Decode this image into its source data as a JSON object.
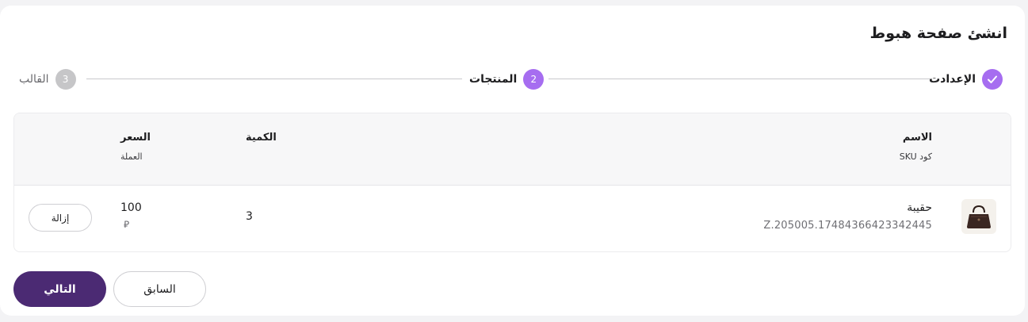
{
  "page": {
    "title": "انشئ صفحة هبوط"
  },
  "stepper": {
    "steps": [
      {
        "number": "1",
        "label": "الإعدادت",
        "state": "completed"
      },
      {
        "number": "2",
        "label": "المنتجات",
        "state": "active"
      },
      {
        "number": "3",
        "label": "القالب",
        "state": "upcoming"
      }
    ],
    "colors": {
      "active": "#a66df0",
      "upcoming": "#c6c6c8"
    }
  },
  "table": {
    "headers": {
      "name": "الاسم",
      "sku": "كود SKU",
      "quantity": "الكمية",
      "price": "السعر",
      "currency": "العملة"
    },
    "rows": [
      {
        "name": "حقيبة",
        "sku": "Z.205005.17484366423342445",
        "quantity": "3",
        "price": "100",
        "currency_symbol": "⃁",
        "image_icon": "handbag-icon",
        "remove_label": "إزالة"
      }
    ]
  },
  "footer": {
    "next_label": "التالي",
    "prev_label": "السابق",
    "primary_color": "#4b2a73"
  }
}
